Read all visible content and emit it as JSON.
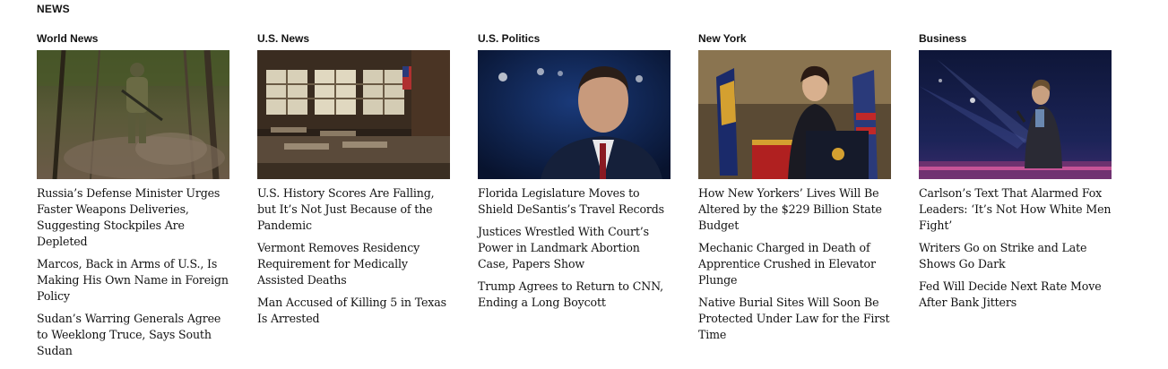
{
  "section": {
    "title": "NEWS"
  },
  "columns": [
    {
      "label": "World News",
      "image_icon": "soldier-forest-photo-icon",
      "headlines": [
        "Russia’s Defense Minister Urges Faster Weapons Deliveries, Suggesting Stockpiles Are Depleted",
        "Marcos, Back in Arms of U.S., Is Making His Own Name in Foreign Policy",
        "Sudan’s Warring Generals Agree to Weeklong Truce, Says South Sudan"
      ]
    },
    {
      "label": "U.S. News",
      "image_icon": "empty-classroom-photo-icon",
      "headlines": [
        "U.S. History Scores Are Falling, but It’s Not Just Because of the Pandemic",
        "Vermont Removes Residency Requirement for Medically Assisted Deaths",
        "Man Accused of Killing 5 in Texas Is Arrested"
      ]
    },
    {
      "label": "U.S. Politics",
      "image_icon": "politician-speaking-photo-icon",
      "headlines": [
        "Florida Legislature Moves to Shield DeSantis’s Travel Records",
        "Justices Wrestled With Court’s Power in Landmark Abortion Case, Papers Show",
        "Trump Agrees to Return to CNN, Ending a Long Boycott"
      ]
    },
    {
      "label": "New York",
      "image_icon": "governor-podium-photo-icon",
      "headlines": [
        "How New Yorkers’ Lives Will Be Altered by the $229 Billion State Budget",
        "Mechanic Charged in Death of Apprentice Crushed in Elevator Plunge",
        "Native Burial Sites Will Soon Be Protected Under Law for the First Time"
      ]
    },
    {
      "label": "Business",
      "image_icon": "stage-speaker-photo-icon",
      "headlines": [
        "Carlson’s Text That Alarmed Fox Leaders: ‘It’s Not How White Men Fight’",
        "Writers Go on Strike and Late Shows Go Dark",
        "Fed Will Decide Next Rate Move After Bank Jitters"
      ]
    }
  ],
  "colors": {
    "text": "#121212",
    "background": "#ffffff"
  }
}
